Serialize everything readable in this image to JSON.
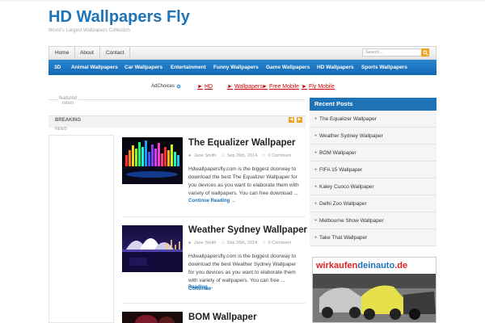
{
  "site": {
    "title": "HD Wallpapers Fly",
    "description": "World's Largest Wallpapers Collection"
  },
  "topnav": {
    "items": [
      "Home",
      "About",
      "Contact"
    ],
    "search_placeholder": "Search ..."
  },
  "catnav": {
    "items": [
      "3D",
      "Animal Wallpapers",
      "Car Wallpapers",
      "Entertainment",
      "Funny Wallpapers",
      "Game Wallpapers",
      "HD Wallpapers",
      "Sports Wallpapers"
    ]
  },
  "ads": {
    "adchoices": "AdChoices",
    "links": [
      "HD",
      "Wallpapers",
      "Free Mobile",
      "Fly Mobile"
    ]
  },
  "featured": {
    "label_line1": "featured",
    "label_line2": "news",
    "breaking": "BREAKING",
    "news": "NEWS"
  },
  "posts": [
    {
      "title": "The Equalizer Wallpaper",
      "author": "Jane Smith",
      "date": "Sep 26th, 2014",
      "comments": "0 Comment",
      "excerpt": "Hdwallpapersfly.com is the biggest doorway to download the best The Equalizer Wallpaper  for you devices as you want to elaborate them with variety of wallpapers. You can free download ...",
      "readmore": "Continue Reading →"
    },
    {
      "title": "Weather Sydney Wallpaper",
      "author": "Jane Smith",
      "date": "Sep 26th, 2014",
      "comments": "0 Comment",
      "excerpt": "Hdwallpapersfly.com is the biggest doorway to download the best Weather Sydney Wallpaper  for you devices as you want to elaborate them with variety of wallpapers. You can free ...",
      "readmore_inline": "Continue",
      "readmore": "Reading →"
    },
    {
      "title": "BOM Wallpaper"
    }
  ],
  "sidebar": {
    "recent_title": "Recent Posts",
    "recent": [
      "The Equalizer Wallpaper",
      "Weather Sydney Wallpaper",
      "BOM Wallpaper",
      "FIFA 15 Wallpaper",
      "Kaley Cuoco Wallpaper",
      "Delhi Zoo Wallpaper",
      "Melbourne Show Wallpaper",
      "Take That Wallpaper"
    ],
    "ad_part1": "wirkaufen",
    "ad_part2": "deinauto",
    "ad_part3": ".de"
  },
  "colors": {
    "brand": "#1f73b7",
    "accent": "#f0a320"
  }
}
